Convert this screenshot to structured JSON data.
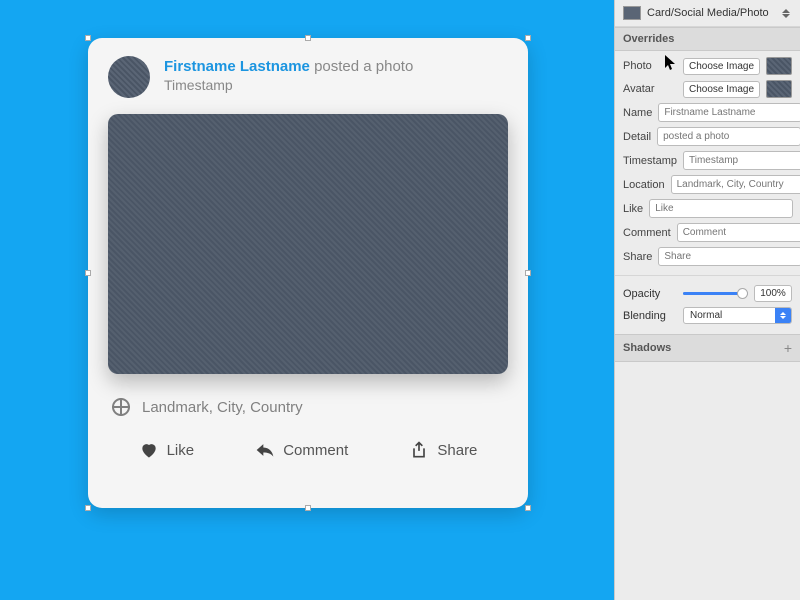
{
  "symbol": {
    "name": "Card/Social Media/Photo"
  },
  "card": {
    "name": "Firstname Lastname",
    "detail": "posted a photo",
    "timestamp": "Timestamp",
    "location": "Landmark, City, Country",
    "actions": {
      "like": "Like",
      "comment": "Comment",
      "share": "Share"
    }
  },
  "overrides": {
    "section_label": "Overrides",
    "photo_label": "Photo",
    "avatar_label": "Avatar",
    "choose_label": "Choose Image",
    "fields": {
      "name": {
        "label": "Name",
        "placeholder": "Firstname Lastname"
      },
      "detail": {
        "label": "Detail",
        "placeholder": "posted a photo"
      },
      "timestamp": {
        "label": "Timestamp",
        "placeholder": "Timestamp"
      },
      "location": {
        "label": "Location",
        "placeholder": "Landmark, City, Country"
      },
      "like": {
        "label": "Like",
        "placeholder": "Like"
      },
      "comment": {
        "label": "Comment",
        "placeholder": "Comment"
      },
      "share": {
        "label": "Share",
        "placeholder": "Share"
      }
    }
  },
  "opacity": {
    "label": "Opacity",
    "value": "100%",
    "percent": 100
  },
  "blending": {
    "label": "Blending",
    "value": "Normal"
  },
  "shadows": {
    "label": "Shadows"
  }
}
